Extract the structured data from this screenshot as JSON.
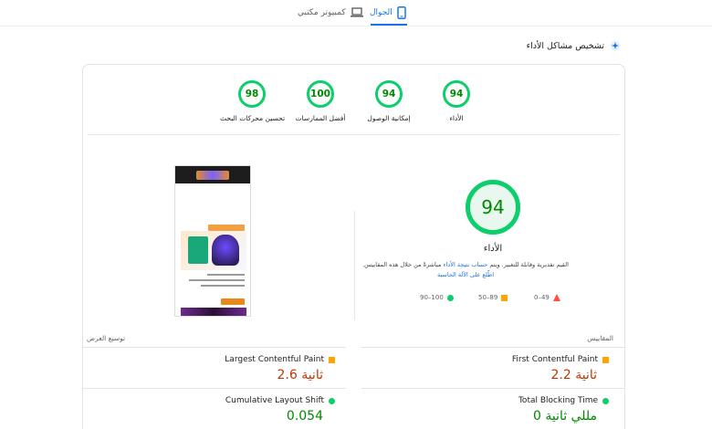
{
  "tabs": {
    "mobile_label": "الجوال",
    "desktop_label": "كمبيوتر مكتبي"
  },
  "diagnose": {
    "title": "تشخيص مشاكل الأداء"
  },
  "categories": [
    {
      "score": "94",
      "label": "الأداء"
    },
    {
      "score": "94",
      "label": "إمكانية الوصول"
    },
    {
      "score": "100",
      "label": "أفضل الممارسات"
    },
    {
      "score": "98",
      "label": "تحسين محركات البحث"
    }
  ],
  "performance": {
    "score": "94",
    "label": "الأداء",
    "description_prefix": "القيم تقديرية وقابلة للتغيير. ويتم ",
    "description_link": "حساب نتيجة الأداء",
    "description_suffix": " مباشرةً من خلال هذه المقاييس. ",
    "calculator_link": "اطّلع على الآلة الحاسبة"
  },
  "legend": {
    "fail": "0–49",
    "average": "50–89",
    "pass": "90–100"
  },
  "sections": {
    "metrics": "المقاييس",
    "expand": "توسيع العرض"
  },
  "metrics": {
    "fcp": {
      "title": "First Contentful Paint",
      "value": "2.2 ثانية"
    },
    "lcp": {
      "title": "Largest Contentful Paint",
      "value": "2.6 ثانية"
    },
    "tbt": {
      "title": "Total Blocking Time",
      "value": "0 مللي ثانية"
    },
    "cls": {
      "title": "Cumulative Layout Shift",
      "value": "0.054"
    }
  },
  "colors": {
    "pass": "#0cce6b",
    "average": "#ffa400",
    "fail": "#ff4e42",
    "accent": "#1a73e8"
  }
}
